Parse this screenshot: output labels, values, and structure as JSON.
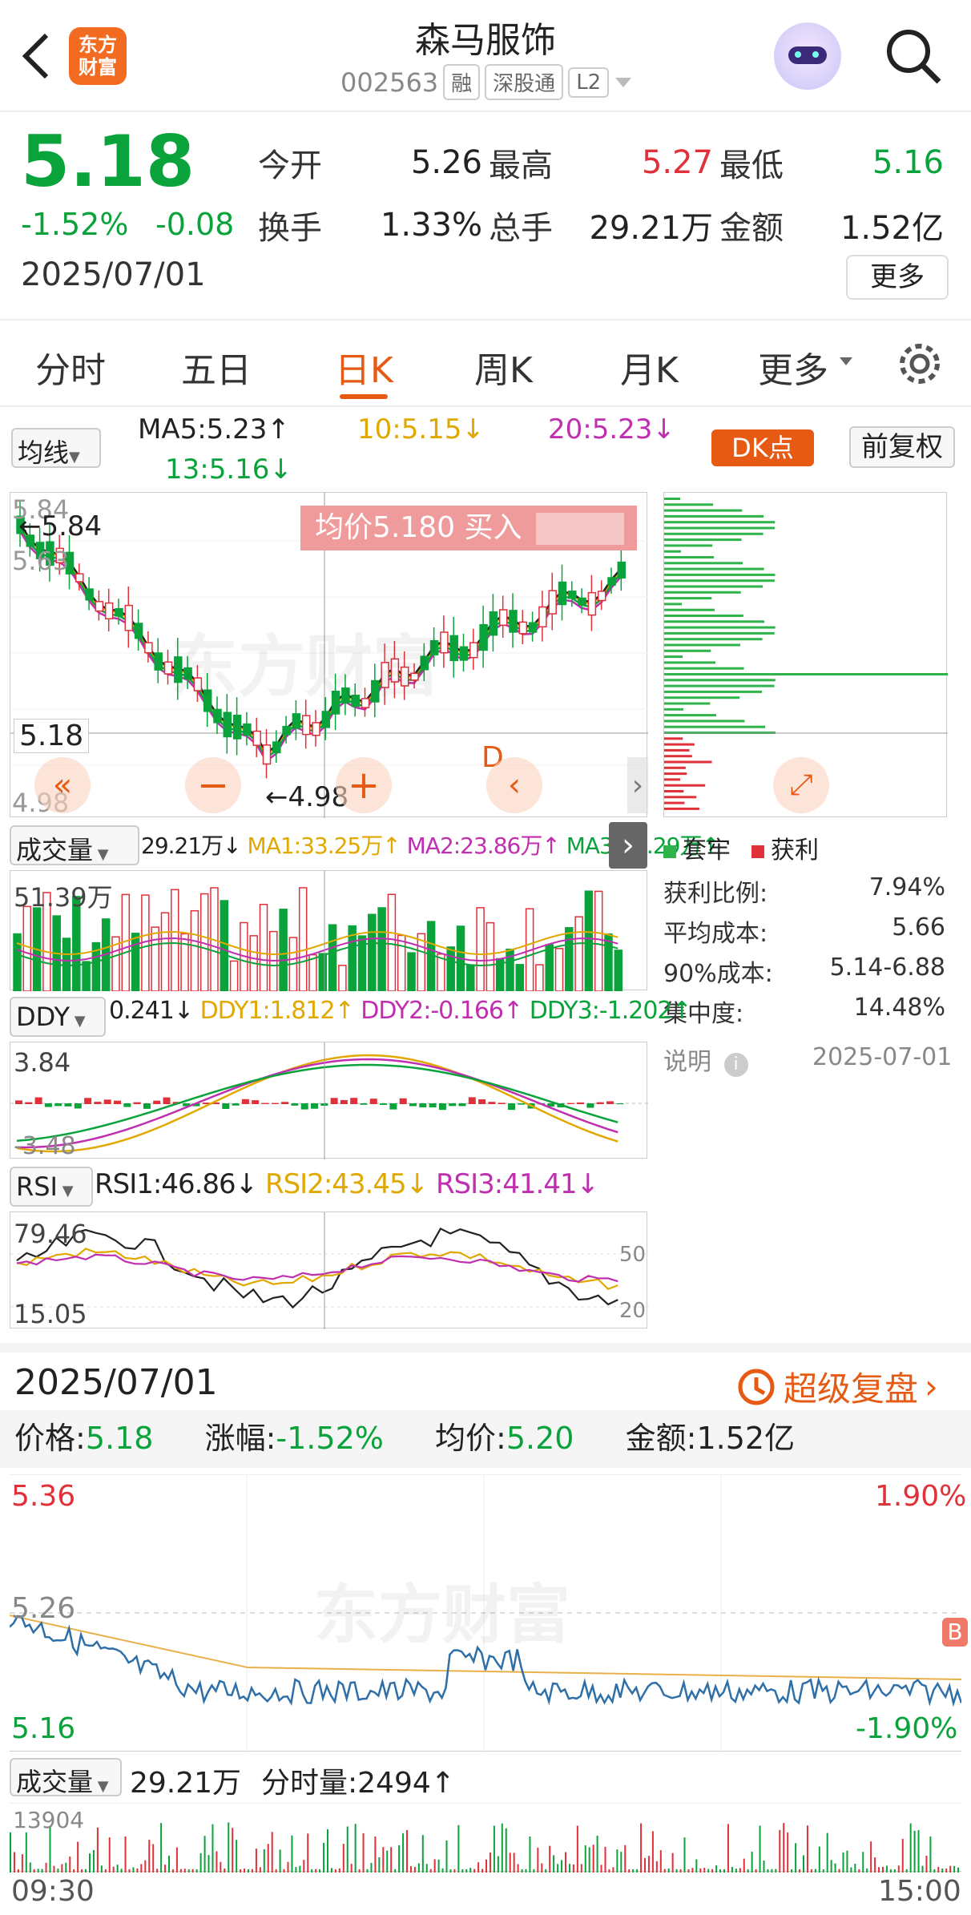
{
  "header": {
    "title": "森马服饰",
    "code": "002563",
    "badges": [
      "融",
      "深股通",
      "L2"
    ],
    "logo_text": [
      "东方",
      "财富"
    ]
  },
  "quote": {
    "price": "5.18",
    "pct": "-1.52%",
    "chg": "-0.08",
    "date": "2025/07/01",
    "rows": [
      [
        {
          "k": "今开",
          "v": "5.26",
          "c": "#222"
        },
        {
          "k": "最高",
          "v": "5.27",
          "c": "#e0313a"
        },
        {
          "k": "最低",
          "v": "5.16",
          "c": "#0aa33b"
        }
      ],
      [
        {
          "k": "换手",
          "v": "1.33%",
          "c": "#222"
        },
        {
          "k": "总手",
          "v": "29.21万",
          "c": "#222"
        },
        {
          "k": "金额",
          "v": "1.52亿",
          "c": "#222"
        }
      ]
    ],
    "more": "更多"
  },
  "tabs": [
    "分时",
    "五日",
    "日K",
    "周K",
    "月K",
    "更多"
  ],
  "ma": {
    "selector": "均线",
    "ma5": "MA5:5.23↑",
    "ma10": "10:5.15↓",
    "ma20": "20:5.23↓",
    "ma13": "13:5.16↓",
    "dk": "DK点",
    "fq": "前复权"
  },
  "kline": {
    "high_label": "5.84",
    "high_arrow": "←5.84",
    "mid_label": "5.63",
    "low_arrow": "←4.98",
    "low_label": "4.98",
    "price_line": "5.18",
    "avg_banner": "均价5.180  买入",
    "d_label": "D"
  },
  "volume": {
    "selector": "成交量",
    "v": "29.21万↓",
    "ma1": "MA1:33.25万↑",
    "ma2": "MA2:23.86万↑",
    "ma3": "MA3:22.29万↑",
    "max": "51.39万"
  },
  "ddy": {
    "selector": "DDY",
    "v": "0.241↓",
    "d1": "DDY1:1.812↑",
    "d2": "DDY2:-0.166↑",
    "d3": "DDY3:-1.202↑",
    "top": "3.84",
    "bot": "-3.48"
  },
  "rsi": {
    "selector": "RSI",
    "r1": "RSI1:46.86↓",
    "r2": "RSI2:43.45↓",
    "r3": "RSI3:41.41↓",
    "top": "79.46",
    "bot": "15.05",
    "l50": "50",
    "l20": "20"
  },
  "chip": {
    "legend_trap": "套牢",
    "legend_profit": "获利",
    "rows": [
      {
        "k": "获利比例:",
        "v": "7.94%"
      },
      {
        "k": "平均成本:",
        "v": "5.66"
      },
      {
        "k": "90%成本:",
        "v": "5.14-6.88"
      },
      {
        "k": "集中度:",
        "v": "14.48%"
      }
    ],
    "note": "说明",
    "note_date": "2025-07-01"
  },
  "replay": {
    "date": "2025/07/01",
    "link": "超级复盘",
    "price": "价格:",
    "price_v": "5.18",
    "chg": "涨幅:",
    "chg_v": "-1.52%",
    "avg": "均价:",
    "avg_v": "5.20",
    "amt": "金额:1.52亿"
  },
  "intraday": {
    "top": "5.36",
    "top_pct": "1.90%",
    "mid": "5.26",
    "low": "5.16",
    "low_pct": "-1.90%",
    "b": "B"
  },
  "ivol": {
    "selector": "成交量",
    "v": "29.21万",
    "fs": "分时量:2494↑",
    "max": "13904",
    "t0": "09:30",
    "t1": "15:00"
  },
  "watermark": "东方财富"
}
